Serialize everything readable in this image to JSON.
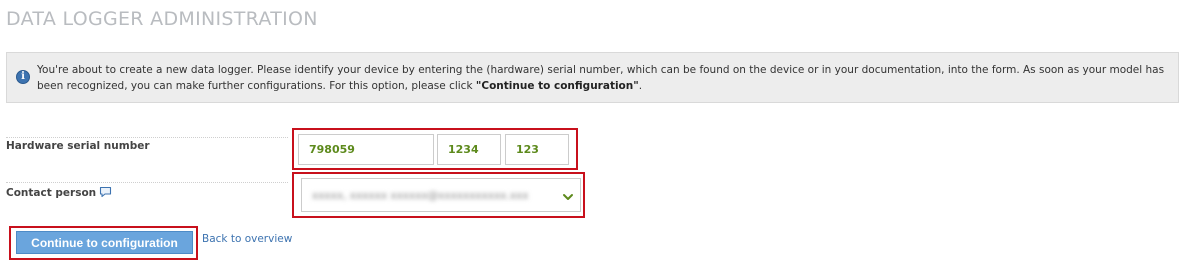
{
  "page": {
    "title": "DATA LOGGER ADMINISTRATION"
  },
  "info": {
    "text_before": "You're about to create a new data logger. Please identify your device by entering the (hardware) serial number, which can be found on the device or in your documentation, into the form. As soon as your model has been recognized, you can make further configurations. For this option, please click ",
    "emphasis": "\"Continue to configuration\"",
    "text_after": "."
  },
  "form": {
    "serial_label": "Hardware serial number",
    "serial_part1": "798059",
    "serial_part2": "1234",
    "serial_part3": "123",
    "contact_label": "Contact person",
    "contact_value": "xxxxx, xxxxxx xxxxxx@xxxxxxxxxxx.xxx"
  },
  "actions": {
    "continue_label": "Continue to configuration",
    "back_label": "Back to overview"
  },
  "colors": {
    "highlight": "#c8101c",
    "button": "#6aa5dd",
    "input_text": "#5d8a1c",
    "link": "#3d73b0"
  }
}
